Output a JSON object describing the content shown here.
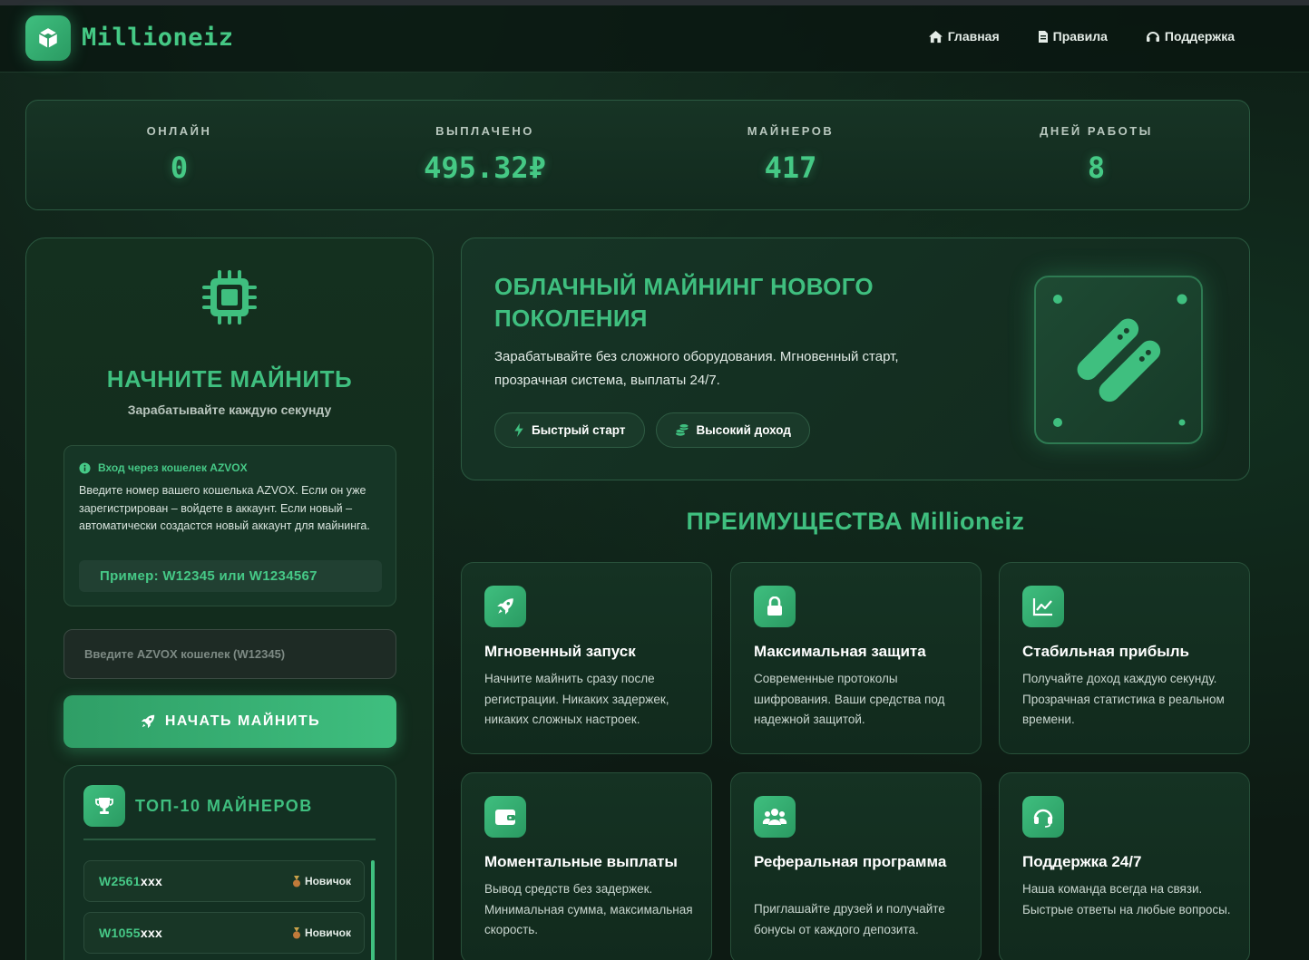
{
  "header": {
    "logo_text": "Millioneiz",
    "nav": [
      {
        "label": "Главная",
        "icon": "home-icon"
      },
      {
        "label": "Правила",
        "icon": "document-icon"
      },
      {
        "label": "Поддержка",
        "icon": "headset-icon"
      }
    ]
  },
  "stats": [
    {
      "label": "ОНЛАЙН",
      "value": "0"
    },
    {
      "label": "ВЫПЛАЧЕНО",
      "value": "495.32₽"
    },
    {
      "label": "МАЙНЕРОВ",
      "value": "417"
    },
    {
      "label": "ДНЕЙ РАБОТЫ",
      "value": "8"
    }
  ],
  "mining_panel": {
    "title": "НАЧНИТЕ МАЙНИТЬ",
    "subtitle": "Зарабатывайте каждую секунду",
    "info": {
      "title": "Вход через кошелек AZVOX",
      "text": "Введите номер вашего кошелька AZVOX. Если он уже зарегистрирован – войдете в аккаунт. Если новый – автоматически создастся новый аккаунт для майнинга.",
      "example": "Пример: W12345 или W1234567"
    },
    "wallet_input": {
      "placeholder": "Введите AZVOX кошелек (W12345)",
      "value": ""
    },
    "start_button": "НАЧАТЬ МАЙНИТЬ"
  },
  "top_miners": {
    "title": "ТОП-10 МАЙНЕРОВ",
    "rows": [
      {
        "id_visible": "W2561",
        "id_masked": "xxx",
        "rank": "Новичок"
      },
      {
        "id_visible": "W1055",
        "id_masked": "xxx",
        "rank": "Новичок"
      }
    ]
  },
  "hero": {
    "title": "ОБЛАЧНЫЙ МАЙНИНГ НОВОГО ПОКОЛЕНИЯ",
    "text": "Зарабатывайте без сложного оборудования. Мгновенный старт, прозрачная система, выплаты 24/7.",
    "tags": [
      {
        "label": "Быстрый старт",
        "icon": "bolt-icon"
      },
      {
        "label": "Высокий доход",
        "icon": "coins-icon"
      }
    ]
  },
  "advantages": {
    "title": "ПРЕИМУЩЕСТВА Millioneiz",
    "cards": [
      {
        "icon": "rocket-icon",
        "title": "Мгновенный запуск",
        "text": "Начните майнить сразу после регистрации. Никаких задержек, никаких сложных настроек."
      },
      {
        "icon": "lock-icon",
        "title": "Максимальная защита",
        "text": "Современные протоколы шифрования. Ваши средства под надежной защитой."
      },
      {
        "icon": "chart-line-icon",
        "title": "Стабильная прибыль",
        "text": "Получайте доход каждую секунду. Прозрачная статистика в реальном времени."
      },
      {
        "icon": "wallet-icon",
        "title": "Моментальные выплаты",
        "text": "Вывод средств без задержек. Минимальная сумма, максимальная скорость."
      },
      {
        "icon": "users-icon",
        "title": "Реферальная программа",
        "text": "Приглашайте друзей и получайте бонусы от каждого депозита."
      },
      {
        "icon": "headset-icon",
        "title": "Поддержка 24/7",
        "text": "Наша команда всегда на связи. Быстрые ответы на любые вопросы."
      }
    ]
  },
  "colors": {
    "accent": "#3fbf7f",
    "background": "#0d1a13",
    "border": "#2b5a41"
  }
}
